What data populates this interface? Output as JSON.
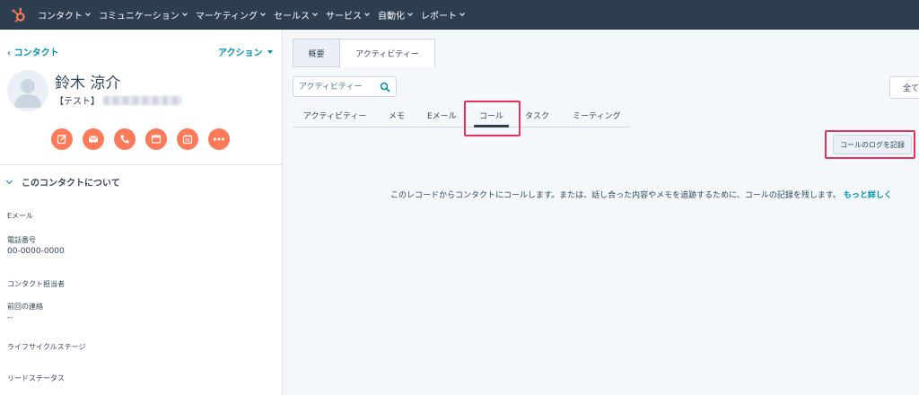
{
  "nav": {
    "items": [
      {
        "label": "コンタクト"
      },
      {
        "label": "コミュニケーション"
      },
      {
        "label": "マーケティング"
      },
      {
        "label": "セールス"
      },
      {
        "label": "サービス"
      },
      {
        "label": "自動化"
      },
      {
        "label": "レポート"
      }
    ],
    "brand_color": "#ff7a59"
  },
  "sidebar": {
    "back_label": "‹ コンタクト",
    "actions_label": "アクション",
    "contact": {
      "name": "鈴木 涼介",
      "company_prefix": "【テスト】"
    },
    "action_icons": [
      "note-icon",
      "email-icon",
      "call-icon",
      "log-icon",
      "task-icon",
      "more-icon"
    ],
    "section_title": "このコンタクトについて",
    "properties": {
      "email_label": "Eメール",
      "phone_label": "電話番号",
      "phone_value": "00-0000-0000",
      "owner_label": "コンタクト担当者",
      "last_contacted_label": "前回の連絡",
      "last_contacted_value": "--",
      "lifecycle_label": "ライフサイクルステージ",
      "lead_status_label": "リードステータス"
    }
  },
  "main": {
    "top_tabs": [
      "概要",
      "アクティビティー"
    ],
    "search": {
      "placeholder": "アクティビティー"
    },
    "all_button": "全て",
    "sub_tabs": [
      "アクティビティー",
      "メモ",
      "Eメール",
      "コール",
      "タスク",
      "ミーティング"
    ],
    "active_sub_tab": "コール",
    "log_call_button": "コールのログを記録",
    "empty_message": "このレコードからコンタクトにコールします。または、話し合った内容やメモを追跡するために、コールの記録を残します。",
    "more_link": "もっと詳しく"
  },
  "colors": {
    "accent": "#0091ae",
    "action": "#ff7a59",
    "highlight": "#e8325e",
    "nav_bg": "#2d3e50"
  }
}
